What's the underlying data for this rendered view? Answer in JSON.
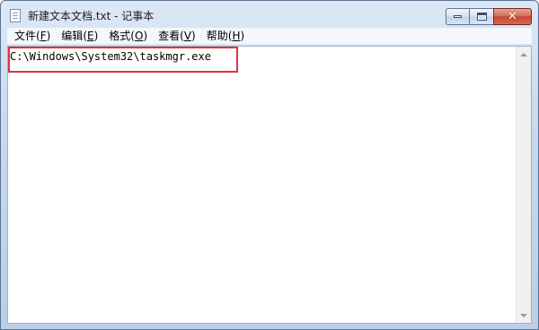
{
  "window": {
    "title": "新建文本文档.txt - 记事本",
    "caption_buttons": {
      "close_glyph": "✕"
    }
  },
  "menu": {
    "items": [
      {
        "label": "文件",
        "mnemonic": "F"
      },
      {
        "label": "编辑",
        "mnemonic": "E"
      },
      {
        "label": "格式",
        "mnemonic": "O"
      },
      {
        "label": "查看",
        "mnemonic": "V"
      },
      {
        "label": "帮助",
        "mnemonic": "H"
      }
    ]
  },
  "editor": {
    "content": "C:\\Windows\\System32\\taskmgr.exe"
  },
  "colors": {
    "highlight_border": "#e0343b",
    "close_button": "#c24a33"
  },
  "icons": {
    "window_icon": "notepad-icon",
    "scroll_up": "scroll-up-arrow-icon",
    "scroll_down": "scroll-down-arrow-icon"
  }
}
